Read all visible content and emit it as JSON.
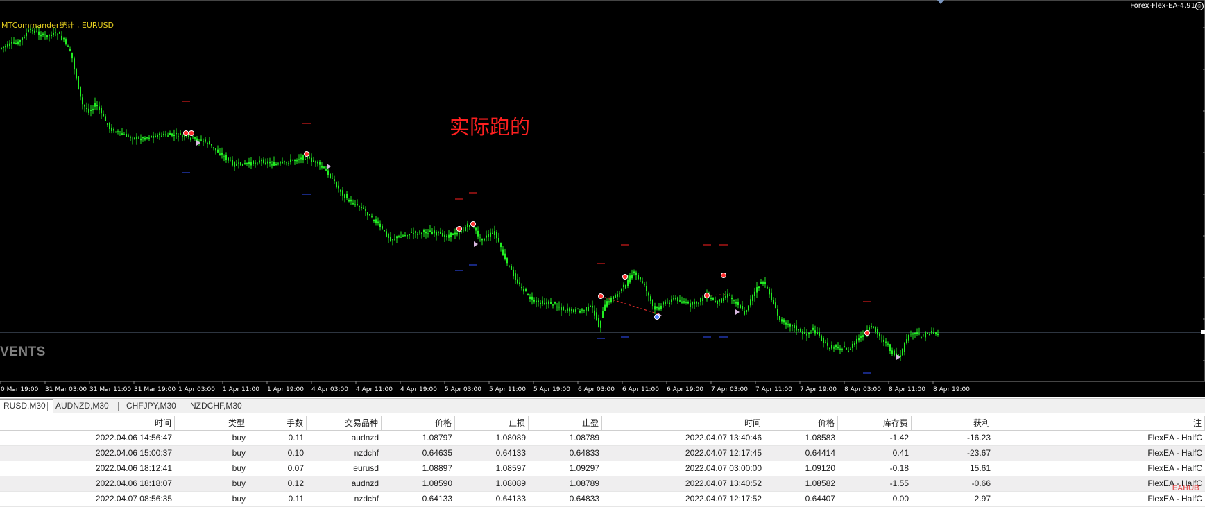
{
  "chart": {
    "ea_name": "Forex-Flex-EA-4.91",
    "indicator_title": "MTCommander统计 , EURUSD",
    "annotation": "实际跑的",
    "events_label": "VENTS",
    "time_axis_labels": [
      "0 Mar 19:00",
      "31 Mar 03:00",
      "31 Mar 11:00",
      "31 Mar 19:00",
      "1 Apr 03:00",
      "1 Apr 11:00",
      "1 Apr 19:00",
      "4 Apr 03:00",
      "4 Apr 11:00",
      "4 Apr 19:00",
      "5 Apr 03:00",
      "5 Apr 11:00",
      "5 Apr 19:00",
      "6 Apr 03:00",
      "6 Apr 11:00",
      "6 Apr 19:00",
      "7 Apr 03:00",
      "7 Apr 11:00",
      "7 Apr 19:00",
      "8 Apr 03:00",
      "8 Apr 11:00",
      "8 Apr 19:00"
    ],
    "colors": {
      "background": "#000000",
      "candle": "#22ee22",
      "sell_marker": "#ff3030",
      "tp_level": "#ff2020",
      "sl_level": "#3050ff",
      "price_line": "#5a6a80",
      "axis_text": "#ffffff"
    }
  },
  "tabs": [
    {
      "label": "RUSD,M30",
      "active": true
    },
    {
      "label": "AUDNZD,M30",
      "active": false
    },
    {
      "label": "CHFJPY,M30",
      "active": false
    },
    {
      "label": "NZDCHF,M30",
      "active": false
    }
  ],
  "table": {
    "headers": [
      "时间",
      "类型",
      "手数",
      "交易品种",
      "价格",
      "止损",
      "止盈",
      "时间",
      "价格",
      "库存费",
      "获利",
      "注"
    ],
    "rows": [
      [
        "2022.04.06 14:56:47",
        "buy",
        "0.11",
        "audnzd",
        "1.08797",
        "1.08089",
        "1.08789",
        "2022.04.07 13:40:46",
        "1.08583",
        "-1.42",
        "-16.23",
        "FlexEA - HalfC"
      ],
      [
        "2022.04.06 15:00:37",
        "buy",
        "0.10",
        "nzdchf",
        "0.64635",
        "0.64133",
        "0.64833",
        "2022.04.07 12:17:45",
        "0.64414",
        "0.41",
        "-23.67",
        "FlexEA - HalfC"
      ],
      [
        "2022.04.06 18:12:41",
        "buy",
        "0.07",
        "eurusd",
        "1.08897",
        "1.08597",
        "1.09297",
        "2022.04.07 03:00:00",
        "1.09120",
        "-0.18",
        "15.61",
        "FlexEA - HalfC"
      ],
      [
        "2022.04.06 18:18:07",
        "buy",
        "0.12",
        "audnzd",
        "1.08590",
        "1.08089",
        "1.08789",
        "2022.04.07 13:40:52",
        "1.08582",
        "-1.55",
        "-0.66",
        "FlexEA - HalfC"
      ],
      [
        "2022.04.07 08:56:35",
        "buy",
        "0.11",
        "nzdchf",
        "0.64133",
        "0.64133",
        "0.64833",
        "2022.04.07 12:17:52",
        "0.64407",
        "0.00",
        "2.97",
        "FlexEA - HalfC"
      ]
    ]
  },
  "watermark": "EAHUB"
}
